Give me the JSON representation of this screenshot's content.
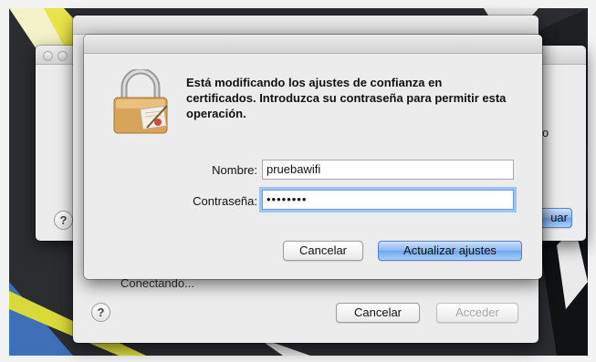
{
  "background_window": {
    "partial_button_label": "uar",
    "partial_text": "o"
  },
  "middle_window": {
    "status_text": "Conectando...",
    "cancel_label": "Cancelar",
    "connect_label": "Acceder",
    "help_label": "?"
  },
  "auth_dialog": {
    "message": "Está modificando los ajustes de confianza en certificados. Introduzca su contraseña para permitir esta operación.",
    "name_label": "Nombre:",
    "name_value": "pruebawifi",
    "password_label": "Contraseña:",
    "password_value": "••••••••",
    "cancel_label": "Cancelar",
    "confirm_label": "Actualizar ajustes",
    "help_label": "?"
  },
  "icons": {
    "lock": "padlock-certificate-icon",
    "help": "help-icon"
  }
}
